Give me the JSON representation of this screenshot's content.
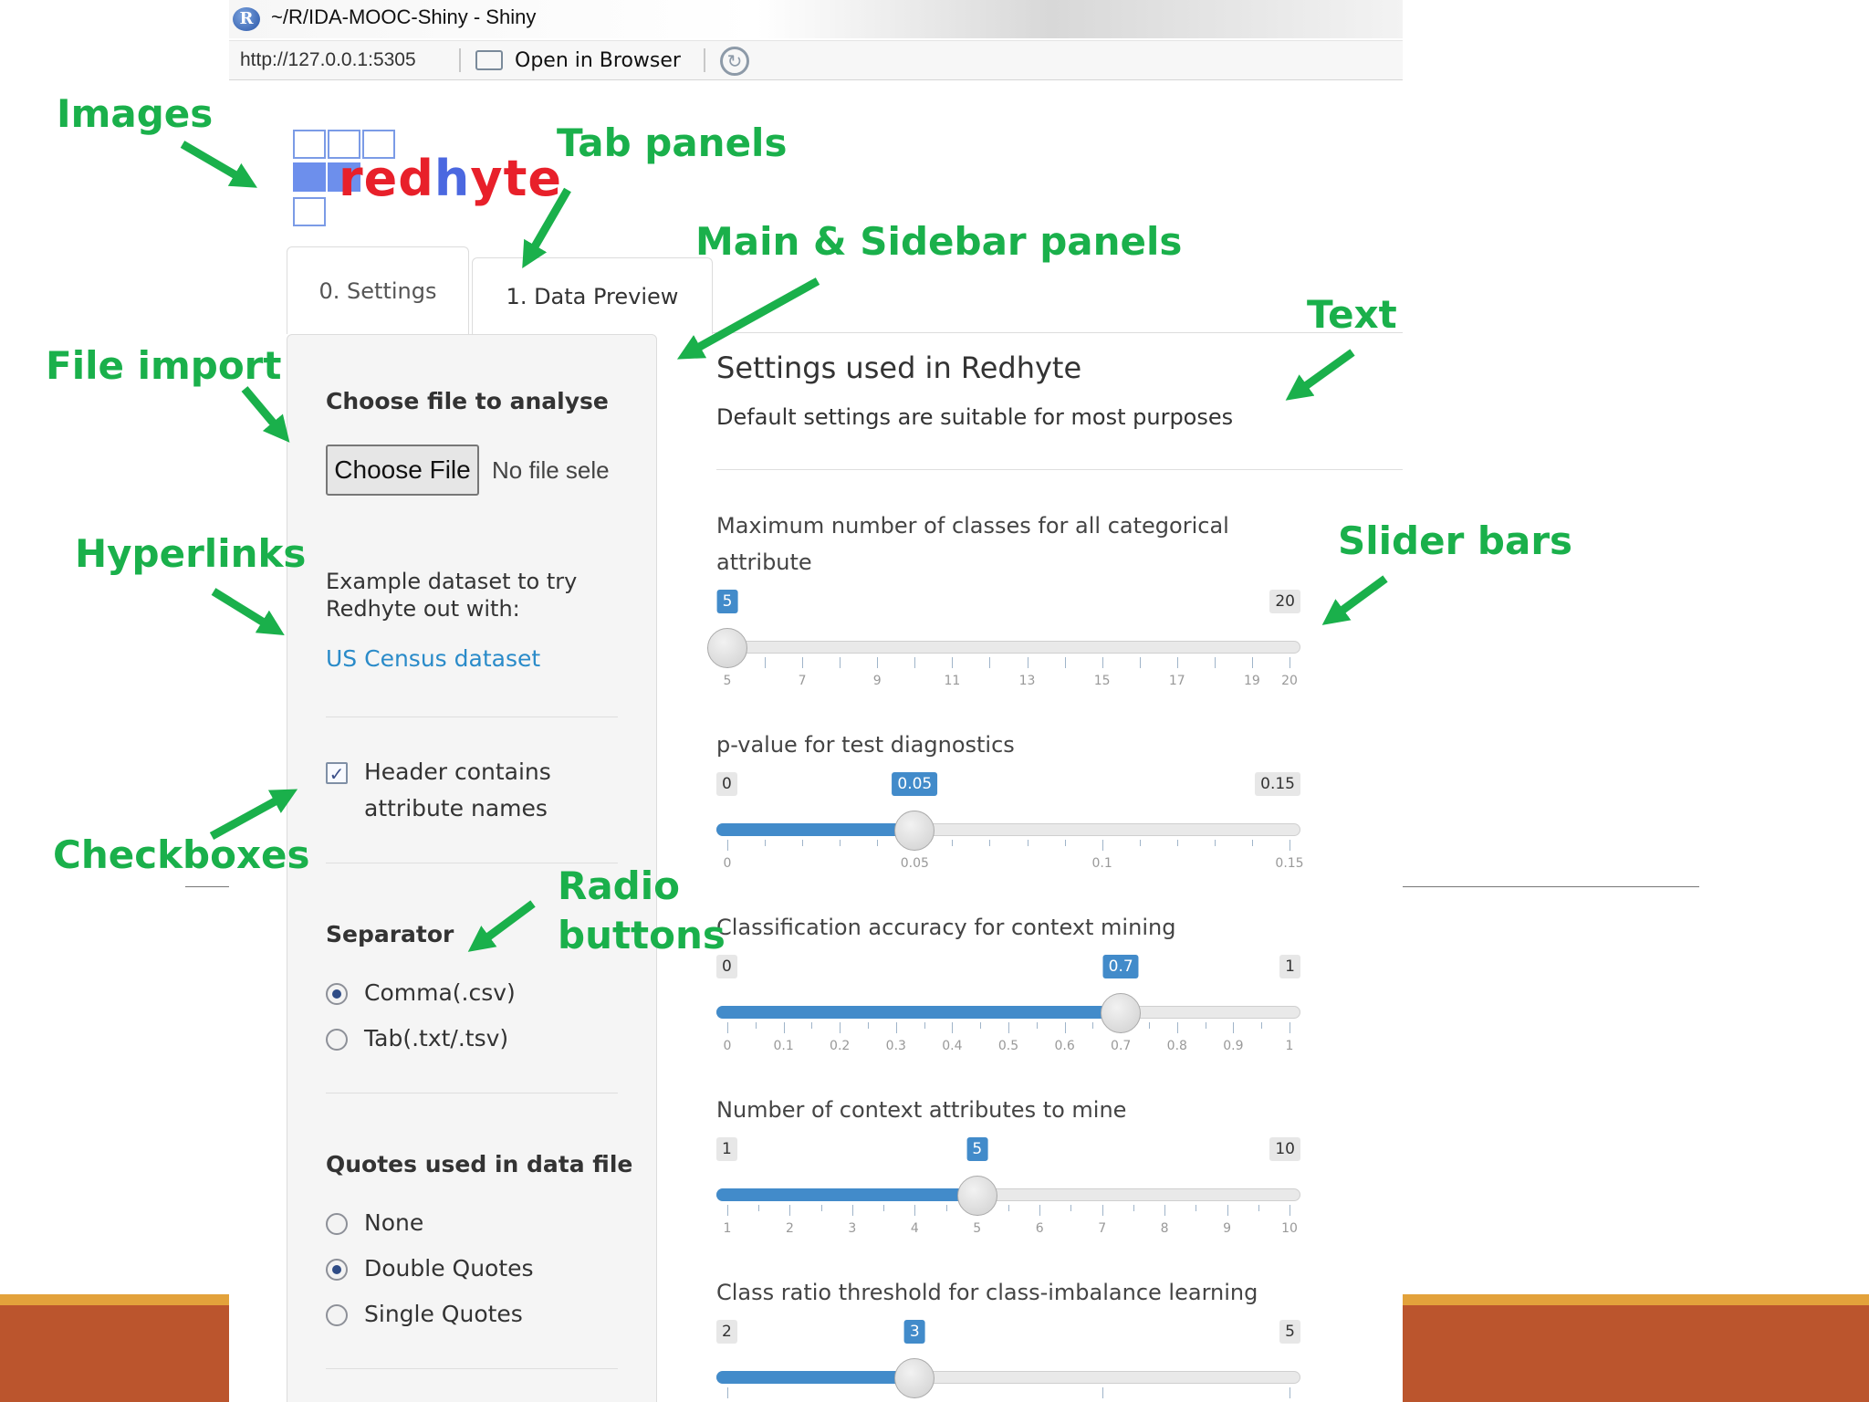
{
  "window": {
    "title": "~/R/IDA-MOOC-Shiny - Shiny",
    "url": "http://127.0.0.1:5305",
    "open_in_browser": "Open in Browser"
  },
  "logo": {
    "part1": "red",
    "part2": "h",
    "part3": "yte"
  },
  "tabs": [
    {
      "label": "0. Settings",
      "active": true
    },
    {
      "label": "1. Data Preview",
      "active": false
    }
  ],
  "sidebar": {
    "file_heading": "Choose file to analyse",
    "choose_file_button": "Choose File",
    "no_file_text": "No file sele",
    "example_text_line1": "Example dataset to try",
    "example_text_line2": "Redhyte out with:",
    "census_link": "US Census dataset",
    "header_checkbox": {
      "line1": "Header contains",
      "line2": "attribute names",
      "checked": true
    },
    "separator": {
      "heading": "Separator",
      "options": [
        {
          "label": "Comma(.csv)",
          "selected": true
        },
        {
          "label": "Tab(.txt/.tsv)",
          "selected": false
        }
      ]
    },
    "quotes": {
      "heading": "Quotes used in data file",
      "options": [
        {
          "label": "None",
          "selected": false
        },
        {
          "label": "Double Quotes",
          "selected": true
        },
        {
          "label": "Single Quotes",
          "selected": false
        }
      ]
    }
  },
  "main": {
    "heading": "Settings used in Redhyte",
    "subtext": "Default settings are suitable for most purposes",
    "sliders": [
      {
        "label_line1": "Maximum number of classes for all categorical",
        "label_line2": "attribute",
        "min": 5,
        "max": 20,
        "value": 5,
        "min_label": "",
        "max_label": "20",
        "value_label": "5",
        "filled": false,
        "major_ticks": 16,
        "minor_per": 0,
        "tick_labels": [
          "5",
          "7",
          "9",
          "11",
          "13",
          "15",
          "17",
          "19",
          "20"
        ],
        "tick_values": [
          5,
          7,
          9,
          11,
          13,
          15,
          17,
          19,
          20
        ]
      },
      {
        "label_line1": "p-value for test diagnostics",
        "label_line2": "",
        "min": 0,
        "max": 0.15,
        "value": 0.05,
        "min_label": "0",
        "max_label": "0.15",
        "value_label": "0.05",
        "filled": true,
        "major_ticks": 4,
        "minor_per": 4,
        "tick_labels": [
          "0",
          "0.05",
          "0.1",
          "0.15"
        ],
        "tick_values": [
          0,
          0.05,
          0.1,
          0.15
        ]
      },
      {
        "label_line1": "Classification accuracy for context mining",
        "label_line2": "",
        "min": 0,
        "max": 1,
        "value": 0.7,
        "min_label": "0",
        "max_label": "1",
        "value_label": "0.7",
        "filled": true,
        "major_ticks": 11,
        "minor_per": 1,
        "tick_labels": [
          "0",
          "0.1",
          "0.2",
          "0.3",
          "0.4",
          "0.5",
          "0.6",
          "0.7",
          "0.8",
          "0.9",
          "1"
        ],
        "tick_values": [
          0,
          0.1,
          0.2,
          0.3,
          0.4,
          0.5,
          0.6,
          0.7,
          0.8,
          0.9,
          1
        ]
      },
      {
        "label_line1": "Number of context attributes to mine",
        "label_line2": "",
        "min": 1,
        "max": 10,
        "value": 5,
        "min_label": "1",
        "max_label": "10",
        "value_label": "5",
        "filled": true,
        "major_ticks": 10,
        "minor_per": 1,
        "tick_labels": [
          "1",
          "2",
          "3",
          "4",
          "5",
          "6",
          "7",
          "8",
          "9",
          "10"
        ],
        "tick_values": [
          1,
          2,
          3,
          4,
          5,
          6,
          7,
          8,
          9,
          10
        ]
      },
      {
        "label_line1": "Class ratio threshold for class-imbalance learning",
        "label_line2": "",
        "min": 2,
        "max": 5,
        "value": 3,
        "min_label": "2",
        "max_label": "5",
        "value_label": "3",
        "filled": true,
        "major_ticks": 4,
        "minor_per": 0,
        "tick_labels": [],
        "tick_values": []
      }
    ]
  },
  "annotations": {
    "images": "Images",
    "tab_panels": "Tab panels",
    "main_sidebar": "Main & Sidebar panels",
    "text": "Text",
    "file_import": "File import",
    "hyperlinks": "Hyperlinks",
    "slider_bars": "Slider bars",
    "checkboxes": "Checkboxes",
    "radio_line1": "Radio",
    "radio_line2": "buttons"
  },
  "colors": {
    "annotation": "#1ab04b",
    "slider_fill": "#428bca",
    "link": "#2a8bc9",
    "footer": "#bb552d"
  },
  "icons": [
    "r-logo-icon",
    "browser-icon",
    "refresh-icon",
    "checkbox-checked-icon",
    "radio-icon"
  ]
}
